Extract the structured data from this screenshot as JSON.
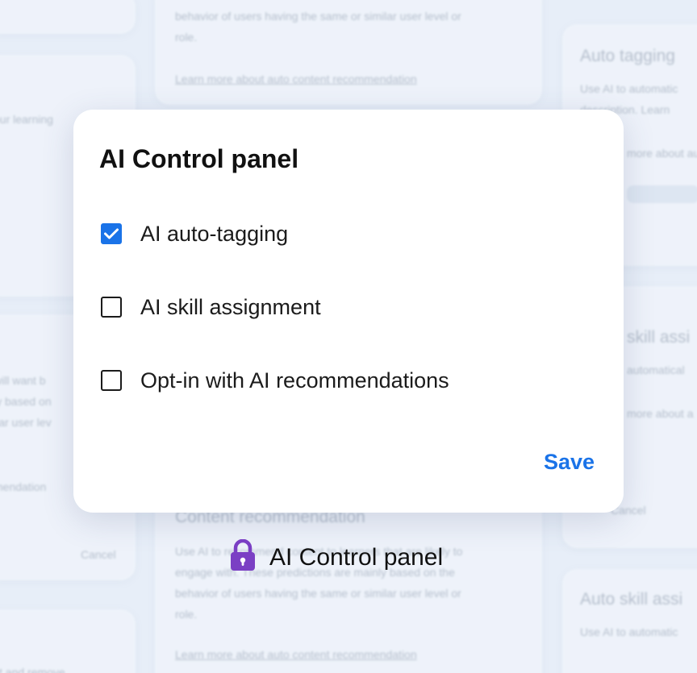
{
  "background": {
    "left_snippets": [
      "our learning",
      "will want b",
      "ly based on",
      "ilar user lev",
      "mendation",
      "Cancel",
      "st and remove"
    ],
    "center_top": {
      "line1": "behavior of users having the same or similar user level or",
      "line2": "role.",
      "link": "Learn more about auto content recommendation"
    },
    "center_bottom": {
      "heading": "Content recommendation",
      "line1": "Use AI to recommend content to learners that are likely to",
      "line2": "engage with. These predictions are mainly based on the",
      "line3": "behavior of users having the same or similar user level or",
      "line4": "role.",
      "link": "Learn more about auto content recommendation"
    },
    "right_top": {
      "heading": "Auto tagging",
      "line1": "Use AI to automatic",
      "line2": "description. Learn",
      "line3": "more about au"
    },
    "right_mid": {
      "heading": "skill assi",
      "line1": "automatical",
      "line2": "more about a",
      "line3": "Cancel"
    },
    "right_bottom": {
      "heading": "Auto skill assi",
      "line1": "Use AI to automatic"
    }
  },
  "modal": {
    "title": "AI Control panel",
    "options": [
      {
        "label": "AI auto-tagging",
        "checked": true
      },
      {
        "label": "AI skill assignment",
        "checked": false
      },
      {
        "label": "Opt-in with AI recommendations",
        "checked": false
      }
    ],
    "save_label": "Save"
  },
  "caption": {
    "icon": "lock-icon",
    "label": "AI Control panel"
  },
  "colors": {
    "accent": "#1a73e8",
    "lock": "#7b3fc4",
    "background": "#e7eef8"
  }
}
